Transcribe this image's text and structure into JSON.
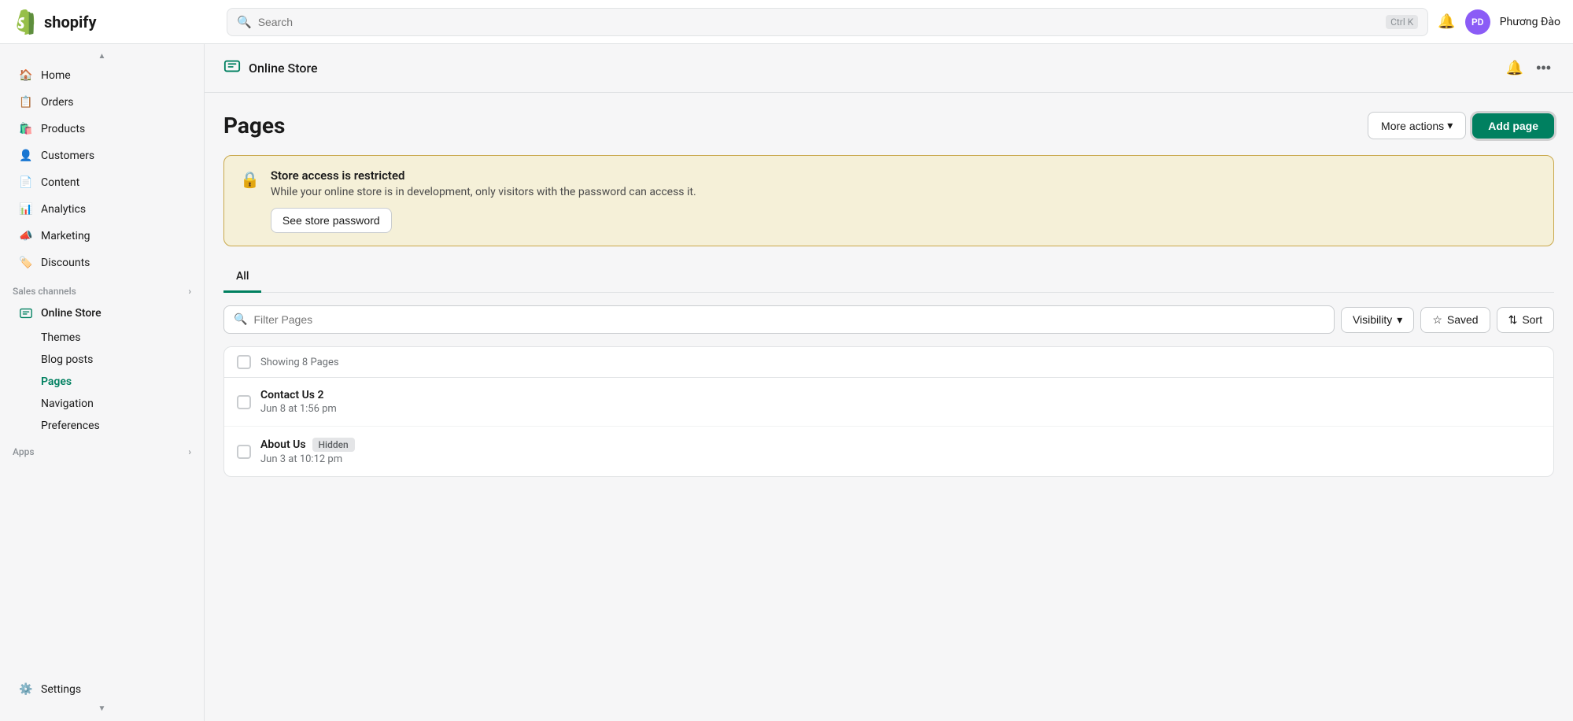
{
  "header": {
    "search_placeholder": "Search",
    "search_shortcut": "Ctrl K",
    "notification_icon": "bell-icon",
    "avatar_initials": "PD",
    "user_name": "Phương Đào"
  },
  "sidebar": {
    "nav_items": [
      {
        "id": "home",
        "label": "Home",
        "icon": "home-icon"
      },
      {
        "id": "orders",
        "label": "Orders",
        "icon": "orders-icon"
      },
      {
        "id": "products",
        "label": "Products",
        "icon": "products-icon"
      },
      {
        "id": "customers",
        "label": "Customers",
        "icon": "customers-icon"
      },
      {
        "id": "content",
        "label": "Content",
        "icon": "content-icon"
      },
      {
        "id": "analytics",
        "label": "Analytics",
        "icon": "analytics-icon"
      },
      {
        "id": "marketing",
        "label": "Marketing",
        "icon": "marketing-icon"
      },
      {
        "id": "discounts",
        "label": "Discounts",
        "icon": "discounts-icon"
      }
    ],
    "sales_channels_label": "Sales channels",
    "sales_channels_expand_icon": "chevron-right-icon",
    "online_store_label": "Online Store",
    "online_store_sub": [
      {
        "id": "themes",
        "label": "Themes"
      },
      {
        "id": "blog-posts",
        "label": "Blog posts"
      },
      {
        "id": "pages",
        "label": "Pages",
        "active": true
      },
      {
        "id": "navigation",
        "label": "Navigation"
      },
      {
        "id": "preferences",
        "label": "Preferences"
      }
    ],
    "apps_label": "Apps",
    "apps_expand_icon": "chevron-right-icon",
    "settings_label": "Settings",
    "settings_icon": "settings-icon"
  },
  "online_store_header": {
    "icon": "online-store-icon",
    "title": "Online Store",
    "bell_icon": "bell-icon",
    "more_icon": "more-dots-icon"
  },
  "pages": {
    "title": "Pages",
    "more_actions_label": "More actions",
    "more_actions_chevron": "chevron-down-icon",
    "add_page_label": "Add page",
    "alert": {
      "lock_icon": "lock-icon",
      "title": "Store access is restricted",
      "description": "While your online store is in development, only visitors with the password can access it.",
      "button_label": "See store password"
    },
    "tabs": [
      {
        "id": "all",
        "label": "All",
        "active": true
      }
    ],
    "filter_placeholder": "Filter Pages",
    "visibility_label": "Visibility",
    "saved_label": "Saved",
    "sort_label": "Sort",
    "showing_count": "Showing 8 Pages",
    "rows": [
      {
        "id": "contact-us-2",
        "title": "Contact Us 2",
        "date": "Jun 8 at 1:56 pm",
        "badge": null
      },
      {
        "id": "about-us",
        "title": "About Us",
        "date": "Jun 3 at 10:12 pm",
        "badge": "Hidden"
      }
    ]
  }
}
